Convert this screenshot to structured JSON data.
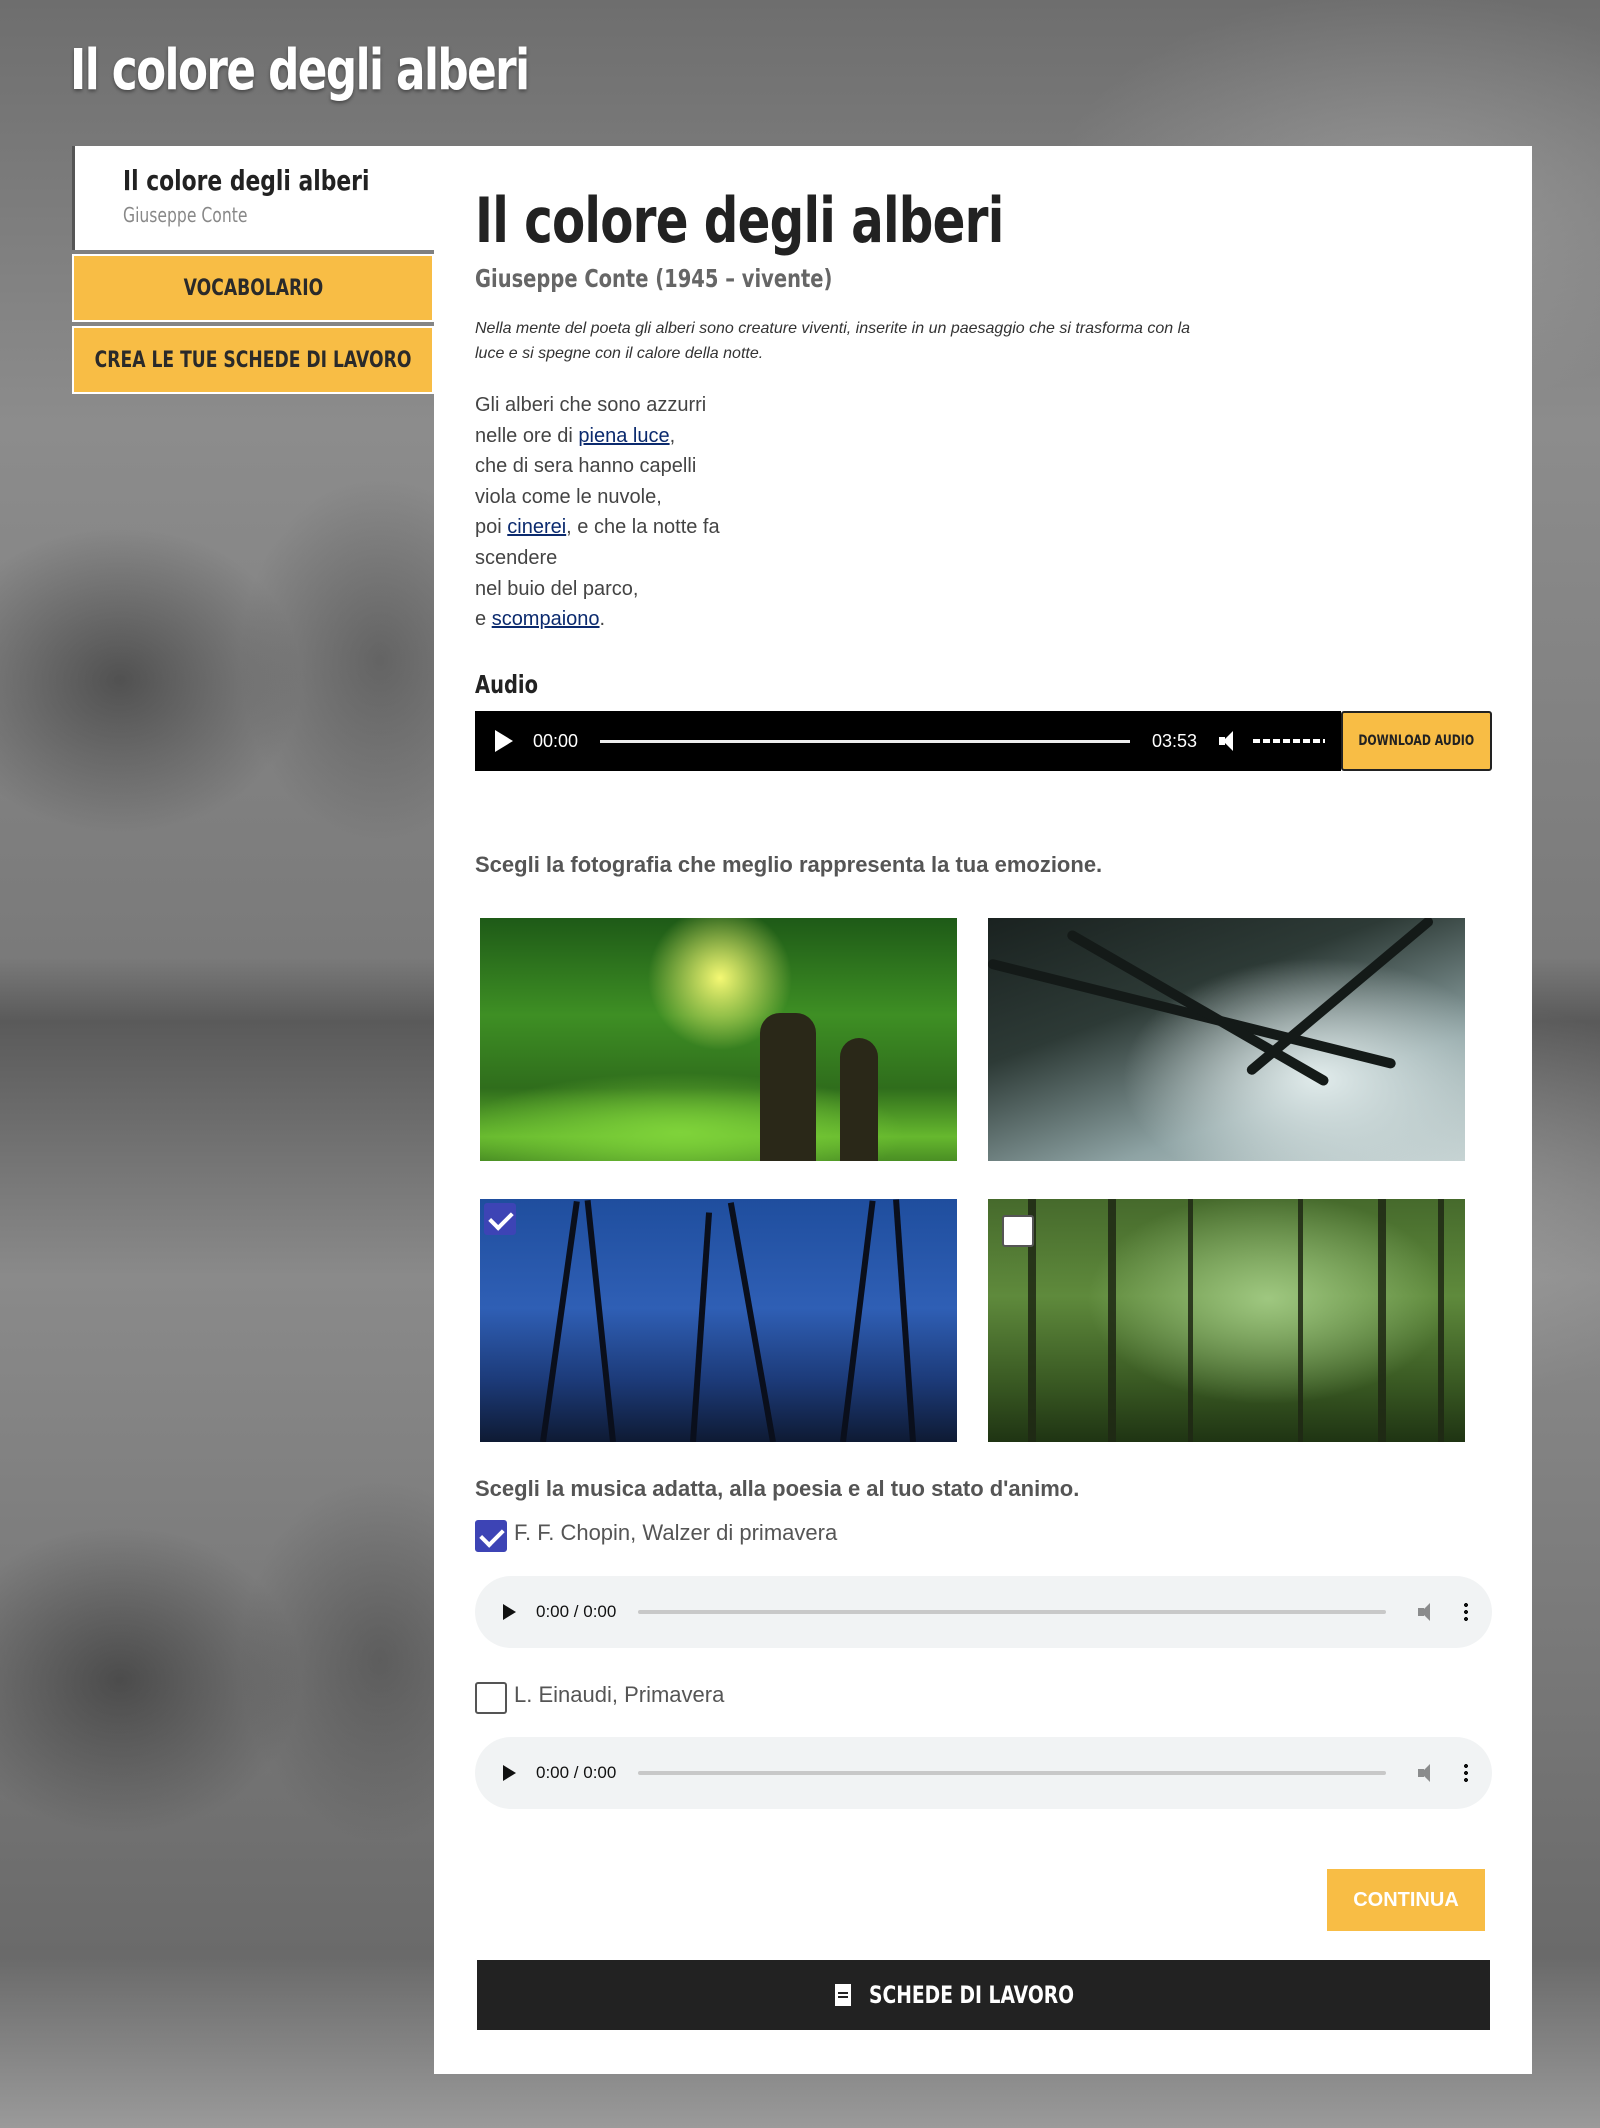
{
  "site_title": "Il colore degli alberi",
  "sidebar": {
    "title": "Il colore degli alberi",
    "author": "Giuseppe Conte",
    "buttons": [
      {
        "label": "VOCABOLARIO"
      },
      {
        "label": "CREA LE TUE SCHEDE DI LAVORO"
      }
    ]
  },
  "main": {
    "title": "Il colore degli alberi",
    "subtitle": "Giuseppe Conte (1945 – vivente)",
    "intro": "Nella mente del poeta gli alberi sono creature viventi, inserite in un paesaggio che si trasforma con la luce e si spegne con il calore della notte.",
    "poem": {
      "l1": "Gli alberi che sono azzurri",
      "l2_pre": "nelle ore di ",
      "l2_link": "piena luce",
      "l2_post": ",",
      "l3": "che di sera hanno capelli",
      "l4": "viola come le nuvole,",
      "l5_pre": "poi ",
      "l5_link": "cinerei",
      "l5_post": ", e che la notte fa",
      "l6": "scendere",
      "l7": "nel buio del parco,",
      "l8_pre": "e ",
      "l8_link": "scompaiono",
      "l8_post": "."
    },
    "audio": {
      "label": "Audio",
      "current": "00:00",
      "duration": "03:53",
      "download_label": "DOWNLOAD AUDIO"
    },
    "question_photo": "Scegli la fotografia che meglio rappresenta la tua emozione.",
    "photos": [
      {
        "name": "sunny-forest-photo",
        "checkbox": "none"
      },
      {
        "name": "misty-branches-photo",
        "checkbox": "none"
      },
      {
        "name": "night-forest-photo",
        "checkbox": "checked"
      },
      {
        "name": "green-fog-forest-photo",
        "checkbox": "unchecked"
      }
    ],
    "question_music": "Scegli la musica adatta, alla poesia e al tuo stato d'animo.",
    "music": [
      {
        "label": "F. F. Chopin, Walzer di primavera",
        "checked": true,
        "time": "0:00 / 0:00"
      },
      {
        "label": "L. Einaudi, Primavera",
        "checked": false,
        "time": "0:00 / 0:00"
      }
    ],
    "continue_label": "CONTINUA",
    "schede_label": "SCHEDE DI LAVORO"
  },
  "colors": {
    "accent": "#f8bd45",
    "dark": "#222222",
    "checkbox_checked": "#3d44b5",
    "link": "#0b2a6e"
  }
}
